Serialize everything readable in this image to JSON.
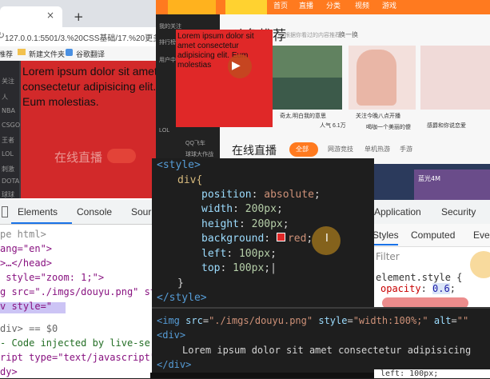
{
  "left_browser": {
    "new_tab": "+",
    "tab_close": "×",
    "url": "127.0.0.1:5501/3.%20CSS基础/17.%20更多",
    "bookmarks": [
      "推荐",
      "新建文件夹",
      "谷歌翻译"
    ],
    "sidebar_labels": [
      "关注",
      "人",
      "NBA",
      "CSGO",
      "王者",
      "LOL",
      "刺激",
      "DOTA",
      "球球"
    ],
    "lorem_text": "Lorem ipsum dolor sit amet consectetur adipisicing elit. Eum molestias.",
    "live_heading": "在线直播",
    "devtools_tabs": [
      "Elements",
      "Console",
      "Sour"
    ],
    "dom_lines": [
      "pe html>",
      "ang=\"en\">",
      ">…</head>",
      " style=\"zoom: 1;\">",
      "g src=\"./imgs/douyu.png\" sty",
      "v style=\"",
      "",
      "div> == $0",
      "- Code injected by live-serv",
      "ript type=\"text/javascript\">",
      "dy>"
    ]
  },
  "right_browser": {
    "nav": [
      "首页",
      "直播",
      "分类",
      "视频",
      "游戏"
    ],
    "sidebar": [
      "我的关注",
      "排行榜",
      "用户中心",
      "LOL",
      "QQ飞车",
      "球球大作战"
    ],
    "section_title": "斗鱼推荐",
    "section_subtitle": "根据你看过的内容推荐",
    "change_label": "换一换",
    "card_texts": [
      "奇太,明白我的意思",
      "关注今晚八点开播",
      "感爵和你说恋爱",
      "人气 6.1万",
      "喝咖一个美丽的傻"
    ],
    "lorem_text": "Lorem ipsum dolor sit amet consectetur adipisicing elit. Eum molestias",
    "live_heading": "在线直播",
    "all_button": "全部",
    "categories": [
      "网游竞技",
      "单机热游",
      "手游"
    ],
    "row2_label": "蓝光4M",
    "watermark": "滚 转"
  },
  "devtools_right": {
    "tabs": [
      "Application",
      "Security"
    ],
    "subtabs": [
      "Styles",
      "Computed",
      "Eve"
    ],
    "filter_placeholder": "Filter",
    "element_style": "element.style {",
    "opacity_prop": "opacity",
    "opacity_value": "0.6",
    "left_line": "left: 100px;"
  },
  "css_code": {
    "lines": {
      "style_open": "<style>",
      "div_open": "div{",
      "position": {
        "prop": "position",
        "value": "absolute"
      },
      "width": {
        "prop": "width",
        "value": "200px"
      },
      "height": {
        "prop": "height",
        "value": "200px"
      },
      "background": {
        "prop": "background",
        "value": "red"
      },
      "left": {
        "prop": "left",
        "value": "100px"
      },
      "top": {
        "prop": "top",
        "value": "100px"
      },
      "div_close": "}",
      "style_close": "</style>"
    },
    "swatch_color": "#e02828"
  },
  "html_code": {
    "img_tag": "<img",
    "img_src_attr": "src",
    "img_src_val": "\"./imgs/douyu.png\"",
    "img_style_attr": "style",
    "img_style_val": "\"width:100%;\"",
    "img_alt_attr": "alt",
    "img_alt_val": "\"\"",
    "div_open": "<div>",
    "lorem": "Lorem ipsum dolor sit amet consectetur adipisicing",
    "div_close": "</div>"
  }
}
